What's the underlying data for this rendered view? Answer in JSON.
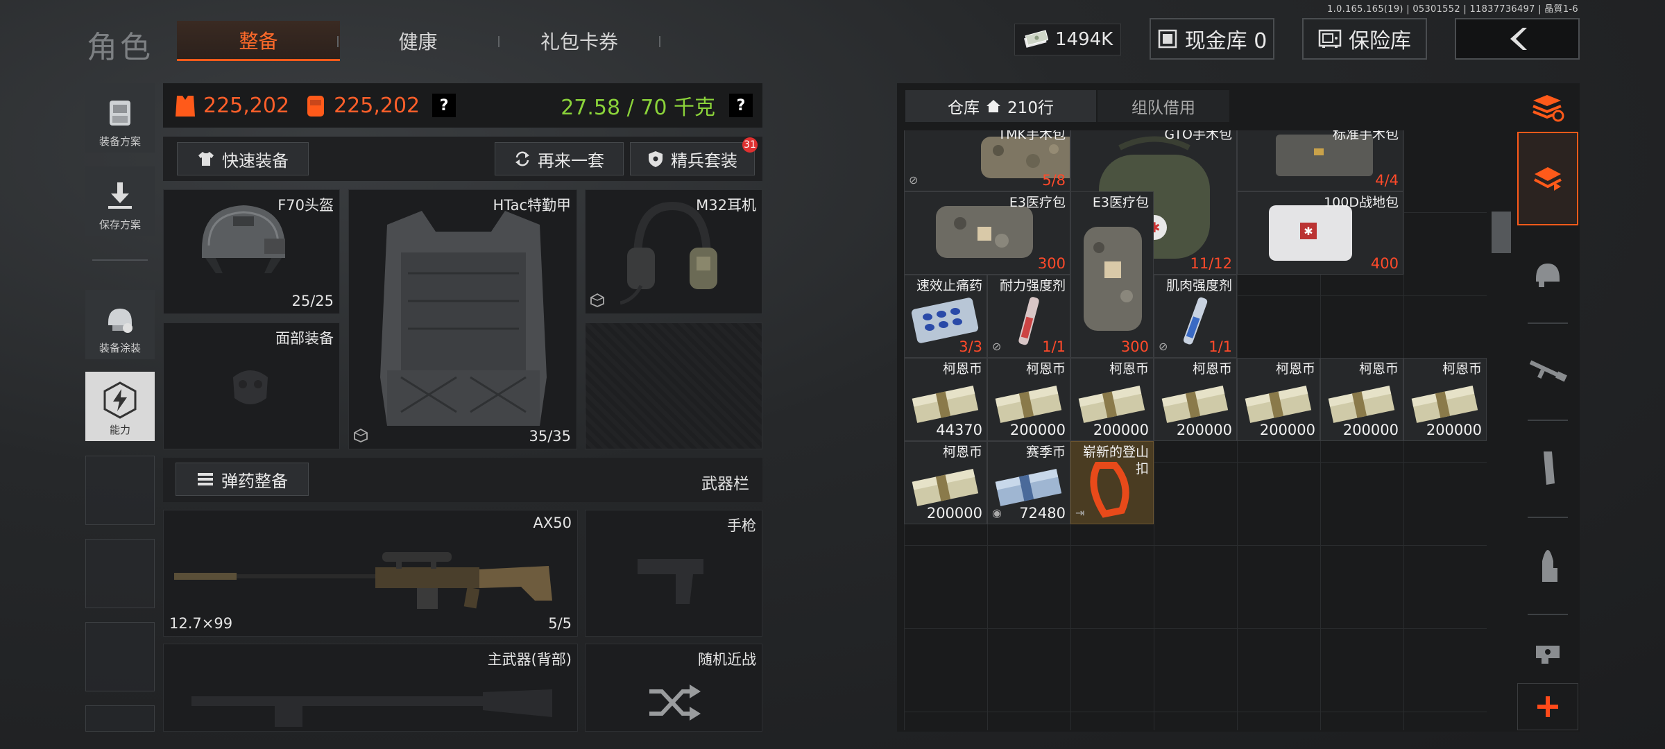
{
  "version_text": "1.0.165.165(19) | 05301552 | 11837736497 | 晶質1-6",
  "header": {
    "title": "角色",
    "tabs": [
      {
        "label": "整备",
        "active": true
      },
      {
        "label": "健康",
        "active": false
      },
      {
        "label": "礼包卡券",
        "active": false
      }
    ],
    "currency": "1494K",
    "cash_vault": "现金库 0",
    "safe_box": "保险库"
  },
  "sidebar": {
    "items": [
      {
        "label": "装备方案",
        "icon": "backpack-icon"
      },
      {
        "label": "保存方案",
        "icon": "save-download-icon"
      },
      {
        "label": "装备涂装",
        "icon": "helmet-paint-icon"
      },
      {
        "label": "能力",
        "icon": "lightning-hex-icon",
        "active": true
      }
    ]
  },
  "stats": {
    "value_a": "225,202",
    "value_b": "225,202",
    "help": "?",
    "weight": "27.58 / 70 千克",
    "weight_help": "?"
  },
  "actions": {
    "quick_equip": "快速装备",
    "again": "再来一套",
    "elite_set": "精兵套装",
    "elite_badge": "31"
  },
  "equipment": {
    "helmet": {
      "name": "F70头盔",
      "count": "25/25"
    },
    "armor": {
      "name": "HTac特勤甲",
      "count": "35/35"
    },
    "headset": {
      "name": "M32耳机"
    },
    "face": {
      "name": "面部装备"
    },
    "ammo_button": "弹药整备",
    "weapon_bar": "武器栏",
    "primary": {
      "name": "AX50",
      "caliber": "12.7×99",
      "count": "5/5"
    },
    "pistol": {
      "name": "手枪"
    },
    "primary_back": {
      "name": "主武器(背部)"
    },
    "melee": {
      "name": "随机近战"
    }
  },
  "warehouse": {
    "tab_storage": "仓库",
    "storage_rows": "210行",
    "tab_team": "组队借用",
    "items": [
      {
        "name": "TMK手术包",
        "count": "5/8",
        "red": true
      },
      {
        "name": "GTO手术包",
        "count": "11/12",
        "red": true
      },
      {
        "name": "标准手术包",
        "count": "4/4",
        "red": true
      },
      {
        "name": "E3医疗包",
        "count": "300",
        "red": true
      },
      {
        "name": "E3医疗包",
        "count": "300",
        "red": true
      },
      {
        "name": "100D战地包",
        "count": "400",
        "red": true
      },
      {
        "name": "速效止痛药",
        "count": "3/3",
        "red": true
      },
      {
        "name": "耐力强度剂",
        "count": "1/1",
        "red": true
      },
      {
        "name": "肌肉强度剂",
        "count": "1/1",
        "red": true
      },
      {
        "name": "柯恩币",
        "count": "44370"
      },
      {
        "name": "柯恩币",
        "count": "200000"
      },
      {
        "name": "柯恩币",
        "count": "200000"
      },
      {
        "name": "柯恩币",
        "count": "200000"
      },
      {
        "name": "柯恩币",
        "count": "200000"
      },
      {
        "name": "柯恩币",
        "count": "200000"
      },
      {
        "name": "柯恩币",
        "count": "200000"
      },
      {
        "name": "柯恩币",
        "count": "200000"
      },
      {
        "name": "赛季币",
        "count": "72480"
      },
      {
        "name": "崭新的登山扣",
        "count": ""
      }
    ]
  },
  "colors": {
    "accent_orange": "#ff5a1a",
    "count_red": "#ff4a2a",
    "weight_green": "#8bd33a"
  }
}
